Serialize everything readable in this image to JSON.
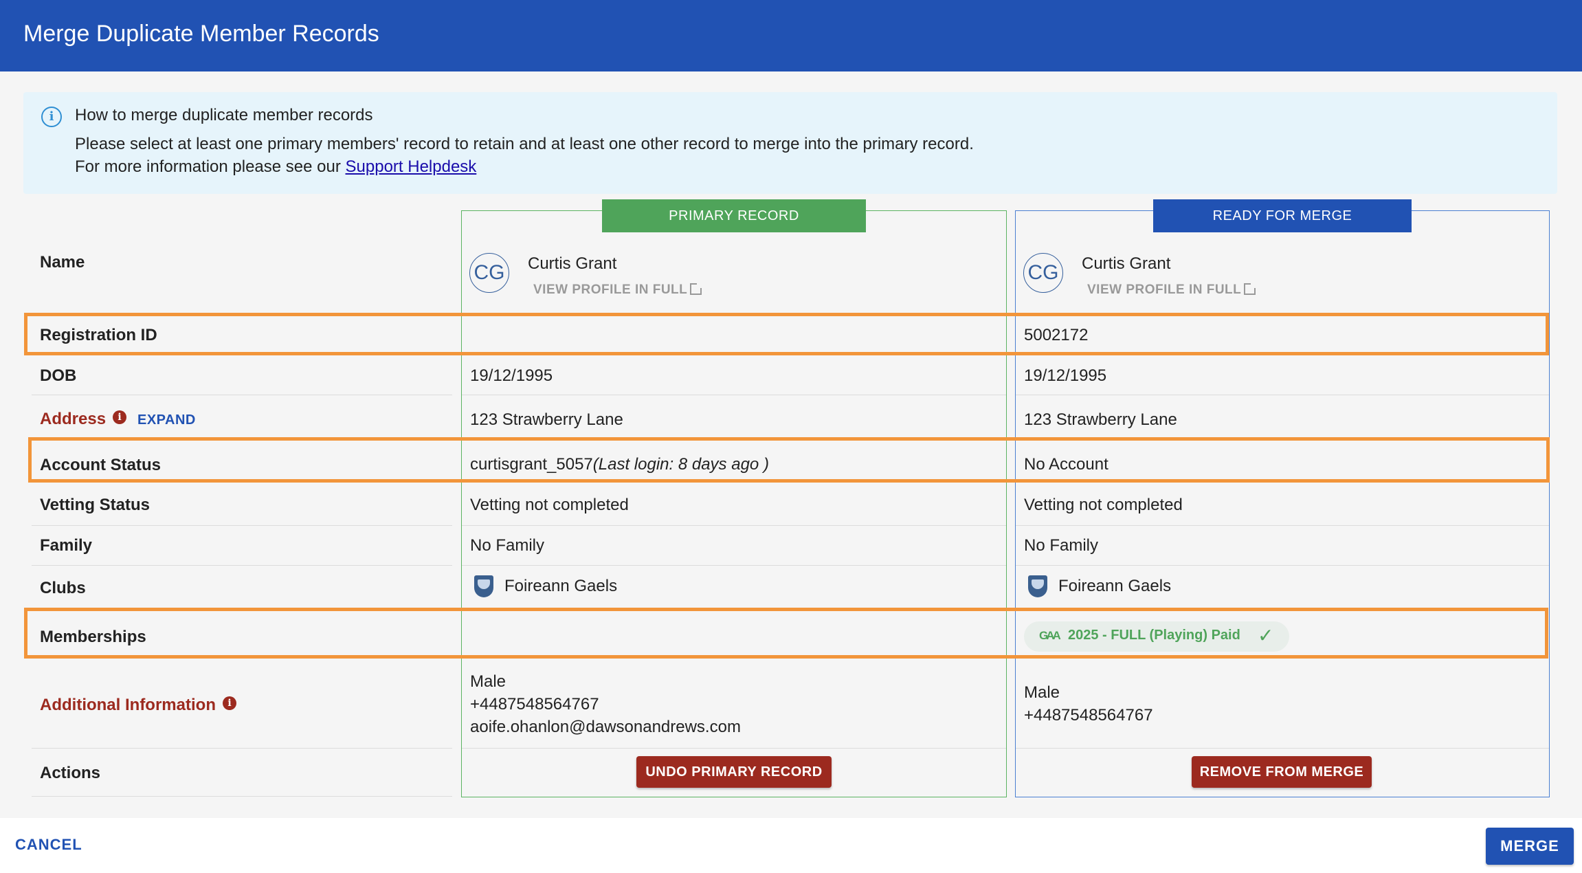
{
  "dialog": {
    "title": "Merge Duplicate Member Records"
  },
  "info": {
    "icon": "info-icon",
    "heading": "How to merge duplicate member records",
    "line1": "Please select at least one primary members' record to retain and at least one other record to merge into the primary record.",
    "line2_prefix": "For more information please see our ",
    "link": "Support Helpdesk"
  },
  "columns": {
    "primary_badge": "PRIMARY RECORD",
    "merge_badge": "READY FOR MERGE"
  },
  "labels": {
    "name": "Name",
    "registration_id": "Registration ID",
    "dob": "DOB",
    "address": "Address",
    "expand": "EXPAND",
    "account_status": "Account Status",
    "vetting_status": "Vetting Status",
    "family": "Family",
    "clubs": "Clubs",
    "memberships": "Memberships",
    "additional_info": "Additional Information",
    "actions": "Actions"
  },
  "primary": {
    "initials": "CG",
    "name": "Curtis Grant",
    "view_profile": "VIEW PROFILE IN FULL",
    "registration_id": "",
    "dob": "19/12/1995",
    "address": "123 Strawberry Lane",
    "account_username": "curtisgrant_5057",
    "account_last_login": "(Last login: 8 days ago )",
    "vetting": "Vetting not completed",
    "family": "No Family",
    "club": "Foireann Gaels",
    "additional": [
      "Male",
      "+4487548564767",
      "aoife.ohanlon@dawsonandrews.com"
    ],
    "action": "UNDO PRIMARY RECORD"
  },
  "merge": {
    "initials": "CG",
    "name": "Curtis Grant",
    "view_profile": "VIEW PROFILE IN FULL",
    "registration_id": "5002172",
    "dob": "19/12/1995",
    "address": "123 Strawberry Lane",
    "account": "No Account",
    "vetting": "Vetting not completed",
    "family": "No Family",
    "club": "Foireann Gaels",
    "membership": "2025 - FULL (Playing) Paid",
    "additional": [
      "Male",
      "+4487548564767"
    ],
    "action": "REMOVE FROM MERGE"
  },
  "footer": {
    "cancel": "CANCEL",
    "merge": "MERGE"
  },
  "colors": {
    "header": "#2152b3",
    "primary_accent": "#4fa45a",
    "danger": "#9c2a1f",
    "highlight": "#f2953a"
  }
}
